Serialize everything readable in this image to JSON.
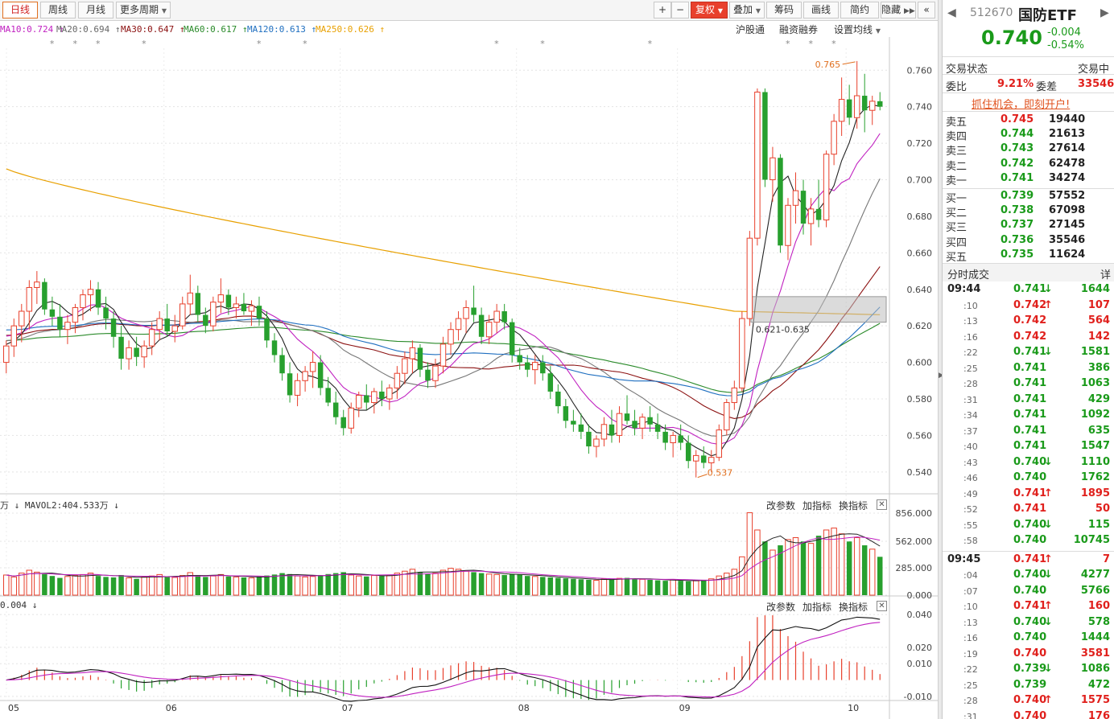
{
  "toolbar": {
    "periods": [
      "日线",
      "周线",
      "月线",
      "更多周期"
    ],
    "active_period": "日线",
    "zoom_in": "+",
    "zoom_out": "−",
    "fuquan": "复权",
    "tools": [
      "叠加",
      "筹码",
      "画线",
      "简约",
      "隐藏"
    ],
    "collapse_icon": "«"
  },
  "ma_legend": [
    {
      "label": "MA10:0.724",
      "arrow": "↑",
      "color": "#c020c0"
    },
    {
      "label": "MA20:0.694",
      "arrow": "↑",
      "color": "#777777"
    },
    {
      "label": "MA30:0.647",
      "arrow": "↑",
      "color": "#8b1010"
    },
    {
      "label": "MA60:0.617",
      "arrow": "↑",
      "color": "#2a8a2a"
    },
    {
      "label": "MA120:0.613",
      "arrow": "↑",
      "color": "#1f6fc0"
    },
    {
      "label": "MA250:0.626",
      "arrow": "↑",
      "color": "#e8a000"
    }
  ],
  "chart_tools": [
    "沪股通",
    "融资融券",
    "设置均线"
  ],
  "annotations": {
    "high": "0.765",
    "low": "0.537",
    "zone": "0.621-0.635"
  },
  "volume_pane": {
    "label": "万 ↓  MAVOL2:404.533万 ↓",
    "tools": [
      "改参数",
      "加指标",
      "换指标"
    ]
  },
  "macd_pane": {
    "label": "0.004 ↓",
    "tools": [
      "改参数",
      "加指标",
      "换指标"
    ]
  },
  "chart_data": [
    {
      "type": "candlestick",
      "title": "",
      "y_ticks": [
        "0.760",
        "0.740",
        "0.720",
        "0.700",
        "0.680",
        "0.660",
        "0.640",
        "0.620",
        "0.600",
        "0.580",
        "0.560",
        "0.540"
      ],
      "ylim": [
        0.532,
        0.772
      ],
      "x_ticks": [
        "05",
        "06",
        "07",
        "08",
        "09",
        "10"
      ],
      "x_tick_index": [
        0,
        21,
        44,
        67,
        88,
        110
      ],
      "ohlc": [
        [
          0.6,
          0.612,
          0.594,
          0.609
        ],
        [
          0.609,
          0.624,
          0.603,
          0.62
        ],
        [
          0.62,
          0.632,
          0.611,
          0.628
        ],
        [
          0.628,
          0.645,
          0.618,
          0.641
        ],
        [
          0.641,
          0.65,
          0.632,
          0.644
        ],
        [
          0.644,
          0.646,
          0.626,
          0.629
        ],
        [
          0.629,
          0.636,
          0.62,
          0.625
        ],
        [
          0.625,
          0.632,
          0.614,
          0.618
        ],
        [
          0.618,
          0.626,
          0.61,
          0.622
        ],
        [
          0.622,
          0.632,
          0.616,
          0.63
        ],
        [
          0.63,
          0.64,
          0.623,
          0.637
        ],
        [
          0.637,
          0.645,
          0.628,
          0.64
        ],
        [
          0.64,
          0.644,
          0.626,
          0.63
        ],
        [
          0.63,
          0.636,
          0.618,
          0.624
        ],
        [
          0.624,
          0.628,
          0.608,
          0.614
        ],
        [
          0.614,
          0.62,
          0.596,
          0.602
        ],
        [
          0.602,
          0.612,
          0.596,
          0.608
        ],
        [
          0.608,
          0.614,
          0.598,
          0.603
        ],
        [
          0.603,
          0.612,
          0.597,
          0.609
        ],
        [
          0.609,
          0.622,
          0.604,
          0.618
        ],
        [
          0.618,
          0.628,
          0.612,
          0.624
        ],
        [
          0.624,
          0.632,
          0.614,
          0.617
        ],
        [
          0.617,
          0.626,
          0.611,
          0.62
        ],
        [
          0.62,
          0.636,
          0.618,
          0.632
        ],
        [
          0.632,
          0.648,
          0.626,
          0.638
        ],
        [
          0.638,
          0.642,
          0.622,
          0.626
        ],
        [
          0.626,
          0.63,
          0.616,
          0.62
        ],
        [
          0.62,
          0.636,
          0.617,
          0.633
        ],
        [
          0.633,
          0.646,
          0.627,
          0.637
        ],
        [
          0.637,
          0.64,
          0.626,
          0.63
        ],
        [
          0.63,
          0.636,
          0.624,
          0.632
        ],
        [
          0.632,
          0.638,
          0.626,
          0.628
        ],
        [
          0.628,
          0.634,
          0.62,
          0.631
        ],
        [
          0.631,
          0.636,
          0.62,
          0.624
        ],
        [
          0.624,
          0.628,
          0.608,
          0.612
        ],
        [
          0.612,
          0.616,
          0.6,
          0.604
        ],
        [
          0.604,
          0.608,
          0.59,
          0.594
        ],
        [
          0.594,
          0.6,
          0.578,
          0.582
        ],
        [
          0.582,
          0.594,
          0.576,
          0.59
        ],
        [
          0.59,
          0.598,
          0.584,
          0.595
        ],
        [
          0.595,
          0.606,
          0.586,
          0.6
        ],
        [
          0.6,
          0.604,
          0.582,
          0.586
        ],
        [
          0.586,
          0.592,
          0.576,
          0.578
        ],
        [
          0.578,
          0.584,
          0.566,
          0.57
        ],
        [
          0.57,
          0.574,
          0.56,
          0.564
        ],
        [
          0.564,
          0.578,
          0.561,
          0.575
        ],
        [
          0.575,
          0.584,
          0.57,
          0.582
        ],
        [
          0.582,
          0.588,
          0.574,
          0.578
        ],
        [
          0.578,
          0.586,
          0.572,
          0.584
        ],
        [
          0.584,
          0.59,
          0.576,
          0.58
        ],
        [
          0.58,
          0.588,
          0.574,
          0.586
        ],
        [
          0.586,
          0.598,
          0.58,
          0.594
        ],
        [
          0.594,
          0.606,
          0.588,
          0.602
        ],
        [
          0.602,
          0.612,
          0.594,
          0.608
        ],
        [
          0.608,
          0.61,
          0.592,
          0.596
        ],
        [
          0.596,
          0.6,
          0.586,
          0.59
        ],
        [
          0.59,
          0.602,
          0.586,
          0.598
        ],
        [
          0.598,
          0.614,
          0.594,
          0.61
        ],
        [
          0.61,
          0.622,
          0.604,
          0.618
        ],
        [
          0.618,
          0.628,
          0.612,
          0.624
        ],
        [
          0.624,
          0.634,
          0.616,
          0.63
        ],
        [
          0.63,
          0.642,
          0.622,
          0.626
        ],
        [
          0.626,
          0.63,
          0.61,
          0.614
        ],
        [
          0.614,
          0.626,
          0.61,
          0.622
        ],
        [
          0.622,
          0.632,
          0.616,
          0.628
        ],
        [
          0.628,
          0.632,
          0.618,
          0.622
        ],
        [
          0.622,
          0.624,
          0.6,
          0.604
        ],
        [
          0.604,
          0.608,
          0.596,
          0.6
        ],
        [
          0.6,
          0.604,
          0.592,
          0.596
        ],
        [
          0.596,
          0.604,
          0.588,
          0.6
        ],
        [
          0.6,
          0.604,
          0.59,
          0.594
        ],
        [
          0.594,
          0.598,
          0.58,
          0.584
        ],
        [
          0.584,
          0.588,
          0.572,
          0.576
        ],
        [
          0.576,
          0.58,
          0.564,
          0.568
        ],
        [
          0.568,
          0.574,
          0.562,
          0.566
        ],
        [
          0.566,
          0.572,
          0.558,
          0.562
        ],
        [
          0.562,
          0.566,
          0.55,
          0.554
        ],
        [
          0.554,
          0.56,
          0.548,
          0.558
        ],
        [
          0.558,
          0.57,
          0.554,
          0.566
        ],
        [
          0.566,
          0.574,
          0.556,
          0.56
        ],
        [
          0.56,
          0.576,
          0.556,
          0.572
        ],
        [
          0.572,
          0.582,
          0.566,
          0.568
        ],
        [
          0.568,
          0.574,
          0.56,
          0.564
        ],
        [
          0.564,
          0.572,
          0.558,
          0.57
        ],
        [
          0.57,
          0.576,
          0.562,
          0.566
        ],
        [
          0.566,
          0.572,
          0.558,
          0.562
        ],
        [
          0.562,
          0.566,
          0.552,
          0.556
        ],
        [
          0.556,
          0.562,
          0.548,
          0.56
        ],
        [
          0.56,
          0.566,
          0.552,
          0.556
        ],
        [
          0.556,
          0.56,
          0.542,
          0.546
        ],
        [
          0.546,
          0.552,
          0.537,
          0.549
        ],
        [
          0.549,
          0.554,
          0.542,
          0.545
        ],
        [
          0.545,
          0.552,
          0.54,
          0.548
        ],
        [
          0.548,
          0.566,
          0.546,
          0.563
        ],
        [
          0.563,
          0.58,
          0.56,
          0.578
        ],
        [
          0.578,
          0.59,
          0.574,
          0.586
        ],
        [
          0.586,
          0.628,
          0.584,
          0.624
        ],
        [
          0.624,
          0.672,
          0.62,
          0.668
        ],
        [
          0.668,
          0.75,
          0.664,
          0.748
        ],
        [
          0.748,
          0.75,
          0.696,
          0.7
        ],
        [
          0.7,
          0.718,
          0.688,
          0.712
        ],
        [
          0.712,
          0.714,
          0.66,
          0.664
        ],
        [
          0.664,
          0.69,
          0.656,
          0.686
        ],
        [
          0.686,
          0.704,
          0.676,
          0.694
        ],
        [
          0.694,
          0.7,
          0.67,
          0.676
        ],
        [
          0.676,
          0.69,
          0.664,
          0.684
        ],
        [
          0.684,
          0.7,
          0.674,
          0.678
        ],
        [
          0.678,
          0.716,
          0.674,
          0.714
        ],
        [
          0.714,
          0.736,
          0.708,
          0.732
        ],
        [
          0.732,
          0.756,
          0.724,
          0.744
        ],
        [
          0.744,
          0.752,
          0.73,
          0.734
        ],
        [
          0.734,
          0.765,
          0.728,
          0.746
        ],
        [
          0.746,
          0.758,
          0.726,
          0.738
        ],
        [
          0.738,
          0.746,
          0.73,
          0.743
        ],
        [
          0.743,
          0.748,
          0.738,
          0.74
        ]
      ],
      "ma_lines": {
        "MA10": {
          "color": "#c020c0",
          "last": 0.724
        },
        "MA20": {
          "color": "#777777",
          "last": 0.694
        },
        "MA30": {
          "color": "#8b1010",
          "last": 0.647
        },
        "MA60": {
          "color": "#2a8a2a",
          "last": 0.617
        },
        "MA120": {
          "color": "#1f6fc0",
          "last": 0.613
        },
        "MA250": {
          "color": "#e8a000",
          "last": 0.626,
          "start": 0.706
        }
      }
    },
    {
      "type": "bar",
      "title": "",
      "y_ticks": [
        "856.000",
        "562.000",
        "285.000",
        "0.000"
      ],
      "ylim": [
        0,
        856
      ],
      "series_note": "volume 万",
      "values": [
        210,
        190,
        230,
        260,
        240,
        220,
        200,
        180,
        195,
        205,
        215,
        230,
        200,
        190,
        185,
        210,
        180,
        170,
        190,
        200,
        215,
        190,
        185,
        205,
        235,
        210,
        190,
        200,
        215,
        195,
        190,
        185,
        180,
        195,
        205,
        215,
        230,
        220,
        200,
        190,
        195,
        210,
        220,
        230,
        240,
        210,
        200,
        195,
        205,
        200,
        210,
        230,
        250,
        270,
        240,
        220,
        230,
        260,
        280,
        270,
        250,
        240,
        230,
        220,
        215,
        210,
        220,
        215,
        200,
        195,
        190,
        185,
        180,
        175,
        170,
        165,
        160,
        155,
        170,
        165,
        175,
        180,
        170,
        165,
        160,
        155,
        150,
        160,
        150,
        145,
        150,
        160,
        170,
        200,
        230,
        270,
        400,
        860,
        680,
        560,
        470,
        520,
        580,
        600,
        560,
        540,
        620,
        680,
        700,
        640,
        560,
        600,
        520,
        480,
        400,
        360
      ]
    },
    {
      "type": "line",
      "title": "",
      "y_ticks": [
        "0.040",
        "0.020",
        "0.010",
        "-0.010"
      ],
      "ylim": [
        -0.012,
        0.043
      ],
      "series_note": "MACD"
    }
  ],
  "quote": {
    "code": "512670",
    "name": "国防ETF",
    "price": "0.740",
    "change": "-0.004",
    "change_pct": "-0.54%",
    "status_label": "交易状态",
    "status_value": "交易中",
    "weibi_label": "委比",
    "weibi_value": "9.21%",
    "weicha_label": "委差",
    "weicha_value": "33546",
    "promo": "抓住机会，即刻开户!"
  },
  "order_book": [
    {
      "label": "卖五",
      "price": "0.745",
      "vol": "19440",
      "color": "red"
    },
    {
      "label": "卖四",
      "price": "0.744",
      "vol": "21613",
      "color": "green"
    },
    {
      "label": "卖三",
      "price": "0.743",
      "vol": "27614",
      "color": "green"
    },
    {
      "label": "卖二",
      "price": "0.742",
      "vol": "62478",
      "color": "green"
    },
    {
      "label": "卖一",
      "price": "0.741",
      "vol": "34274",
      "color": "green"
    },
    {
      "label": "买一",
      "price": "0.739",
      "vol": "57552",
      "color": "green"
    },
    {
      "label": "买二",
      "price": "0.738",
      "vol": "67098",
      "color": "green"
    },
    {
      "label": "买三",
      "price": "0.737",
      "vol": "27145",
      "color": "green"
    },
    {
      "label": "买四",
      "price": "0.736",
      "vol": "35546",
      "color": "green"
    },
    {
      "label": "买五",
      "price": "0.735",
      "vol": "11624",
      "color": "green"
    }
  ],
  "ticks_header": {
    "title": "分时成交",
    "detail": "详"
  },
  "ticks": [
    {
      "time": "09:44",
      "big": true,
      "price": "0.741",
      "arrow": "down",
      "vol": "1644",
      "vcolor": "green"
    },
    {
      "time": ":10",
      "big": false,
      "price": "0.742",
      "arrow": "up",
      "vol": "107",
      "vcolor": "red"
    },
    {
      "time": ":13",
      "big": false,
      "price": "0.742",
      "arrow": "",
      "vol": "564",
      "vcolor": "red"
    },
    {
      "time": ":16",
      "big": false,
      "price": "0.742",
      "arrow": "",
      "vol": "142",
      "vcolor": "red"
    },
    {
      "time": ":22",
      "big": false,
      "price": "0.741",
      "arrow": "down",
      "vol": "1581",
      "vcolor": "green"
    },
    {
      "time": ":25",
      "big": false,
      "price": "0.741",
      "arrow": "",
      "vol": "386",
      "vcolor": "green"
    },
    {
      "time": ":28",
      "big": false,
      "price": "0.741",
      "arrow": "",
      "vol": "1063",
      "vcolor": "green"
    },
    {
      "time": ":31",
      "big": false,
      "price": "0.741",
      "arrow": "",
      "vol": "429",
      "vcolor": "green"
    },
    {
      "time": ":34",
      "big": false,
      "price": "0.741",
      "arrow": "",
      "vol": "1092",
      "vcolor": "green"
    },
    {
      "time": ":37",
      "big": false,
      "price": "0.741",
      "arrow": "",
      "vol": "635",
      "vcolor": "green"
    },
    {
      "time": ":40",
      "big": false,
      "price": "0.741",
      "arrow": "",
      "vol": "1547",
      "vcolor": "green"
    },
    {
      "time": ":43",
      "big": false,
      "price": "0.740",
      "arrow": "down",
      "vol": "1110",
      "vcolor": "green"
    },
    {
      "time": ":46",
      "big": false,
      "price": "0.740",
      "arrow": "",
      "vol": "1762",
      "vcolor": "green"
    },
    {
      "time": ":49",
      "big": false,
      "price": "0.741",
      "arrow": "up",
      "vol": "1895",
      "vcolor": "red"
    },
    {
      "time": ":52",
      "big": false,
      "price": "0.741",
      "arrow": "",
      "vol": "50",
      "vcolor": "red"
    },
    {
      "time": ":55",
      "big": false,
      "price": "0.740",
      "arrow": "down",
      "vol": "115",
      "vcolor": "green"
    },
    {
      "time": ":58",
      "big": false,
      "price": "0.740",
      "arrow": "",
      "vol": "10745",
      "vcolor": "green"
    },
    {
      "time": "09:45",
      "big": true,
      "price": "0.741",
      "arrow": "up",
      "vol": "7",
      "vcolor": "red"
    },
    {
      "time": ":04",
      "big": false,
      "price": "0.740",
      "arrow": "down",
      "vol": "4277",
      "vcolor": "green"
    },
    {
      "time": ":07",
      "big": false,
      "price": "0.740",
      "arrow": "",
      "vol": "5766",
      "vcolor": "green"
    },
    {
      "time": ":10",
      "big": false,
      "price": "0.741",
      "arrow": "up",
      "vol": "160",
      "vcolor": "red"
    },
    {
      "time": ":13",
      "big": false,
      "price": "0.740",
      "arrow": "down",
      "vol": "578",
      "vcolor": "green"
    },
    {
      "time": ":16",
      "big": false,
      "price": "0.740",
      "arrow": "",
      "vol": "1444",
      "vcolor": "green"
    },
    {
      "time": ":19",
      "big": false,
      "price": "0.740",
      "arrow": "",
      "vol": "3581",
      "vcolor": "red"
    },
    {
      "time": ":22",
      "big": false,
      "price": "0.739",
      "arrow": "down",
      "vol": "1086",
      "vcolor": "green"
    },
    {
      "time": ":25",
      "big": false,
      "price": "0.739",
      "arrow": "",
      "vol": "472",
      "vcolor": "green"
    },
    {
      "time": ":28",
      "big": false,
      "price": "0.740",
      "arrow": "up",
      "vol": "1575",
      "vcolor": "red"
    },
    {
      "time": ":31",
      "big": false,
      "price": "0.740",
      "arrow": "",
      "vol": "176",
      "vcolor": "red"
    }
  ]
}
